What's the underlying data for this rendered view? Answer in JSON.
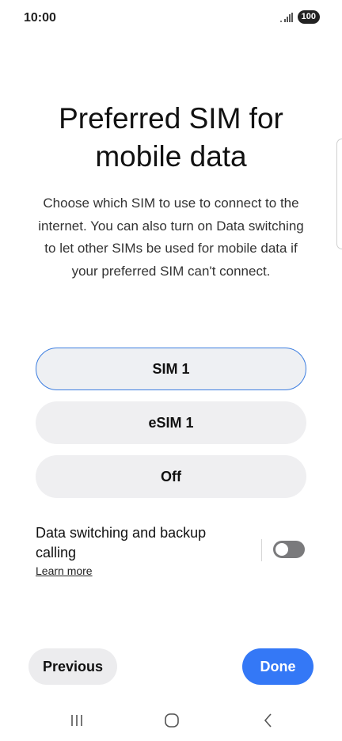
{
  "status_bar": {
    "time": "10:00",
    "battery": "100",
    "signal_icon": "signal-icon"
  },
  "page": {
    "title": "Preferred SIM for mobile data",
    "description": "Choose which SIM to use to connect to the internet. You can also turn on Data switching to let other SIMs be used for mobile data if your preferred SIM can't connect."
  },
  "options": [
    {
      "label": "SIM 1",
      "selected": true
    },
    {
      "label": "eSIM 1",
      "selected": false
    },
    {
      "label": "Off",
      "selected": false
    }
  ],
  "data_switching": {
    "title": "Data switching and backup calling",
    "learn_more": "Learn more",
    "enabled": false
  },
  "footer": {
    "previous_label": "Previous",
    "done_label": "Done"
  },
  "navigation": {
    "recents_icon": "recents-icon",
    "home_icon": "home-icon",
    "back_icon": "back-icon"
  },
  "colors": {
    "accent": "#3478f6",
    "selected_border": "#3b7de0",
    "option_bg": "#efeff1",
    "toggle_off": "#7a7a7c"
  }
}
